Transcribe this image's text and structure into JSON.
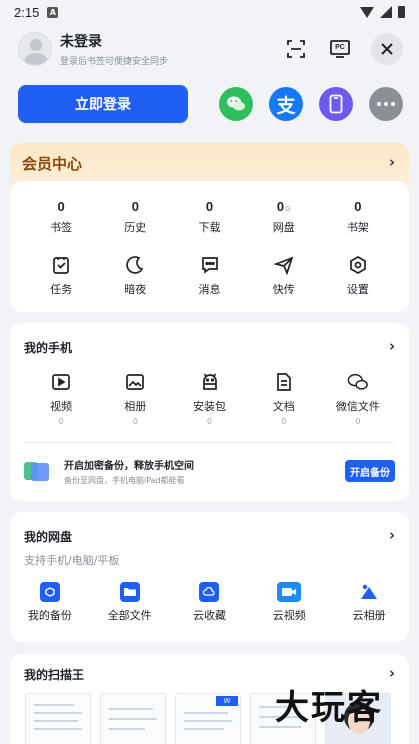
{
  "status_bar": {
    "time": "2:15"
  },
  "header": {
    "user_name": "未登录",
    "user_sub": "登录后书签可便捷安全同步",
    "pc_label": "PC"
  },
  "login": {
    "button_label": "立即登录",
    "quick_icons": [
      "wechat-icon",
      "alipay-icon",
      "phone-icon",
      "more-icon"
    ]
  },
  "member": {
    "title": "会员中心",
    "stats": [
      {
        "num": "0",
        "label": "书签"
      },
      {
        "num": "0",
        "label": "历史"
      },
      {
        "num": "0",
        "label": "下载"
      },
      {
        "num": "0",
        "label": "网盘",
        "unit": "G"
      },
      {
        "num": "0",
        "label": "书架"
      }
    ],
    "tools": [
      {
        "label": "任务",
        "icon": "task-icon"
      },
      {
        "label": "暗夜",
        "icon": "moon-icon"
      },
      {
        "label": "消息",
        "icon": "message-icon"
      },
      {
        "label": "快传",
        "icon": "send-icon"
      },
      {
        "label": "设置",
        "icon": "settings-icon"
      }
    ]
  },
  "my_phone": {
    "title": "我的手机",
    "items": [
      {
        "label": "视频",
        "count": "0",
        "icon": "video-icon"
      },
      {
        "label": "相册",
        "count": "0",
        "icon": "album-icon"
      },
      {
        "label": "安装包",
        "count": "0",
        "icon": "android-icon"
      },
      {
        "label": "文档",
        "count": "0",
        "icon": "document-icon"
      },
      {
        "label": "微信文件",
        "count": "0",
        "icon": "wechat-file-icon"
      }
    ],
    "backup": {
      "title": "开启加密备份，释放手机空间",
      "subtitle": "备份至网盘，手机电脑iPad都能看",
      "button_label": "开启备份"
    }
  },
  "my_disk": {
    "title": "我的网盘",
    "subtitle": "支持手机/电脑/平板",
    "items": [
      {
        "label": "我的备份",
        "icon": "backup-icon"
      },
      {
        "label": "全部文件",
        "icon": "folder-icon"
      },
      {
        "label": "云收藏",
        "icon": "cloud-folder-icon"
      },
      {
        "label": "云视频",
        "icon": "cloud-video-icon"
      },
      {
        "label": "云相册",
        "icon": "cloud-album-icon"
      }
    ]
  },
  "scanner": {
    "title": "我的扫描王",
    "watermark": "大玩客",
    "thumb_badge": "W"
  },
  "colors": {
    "primary": "#1f5ff5",
    "wechat": "#2fbf5a",
    "alipay": "#1677ff",
    "phone": "#6d5bf0",
    "more": "#8c8f96",
    "member_title": "#8a4a0f"
  }
}
